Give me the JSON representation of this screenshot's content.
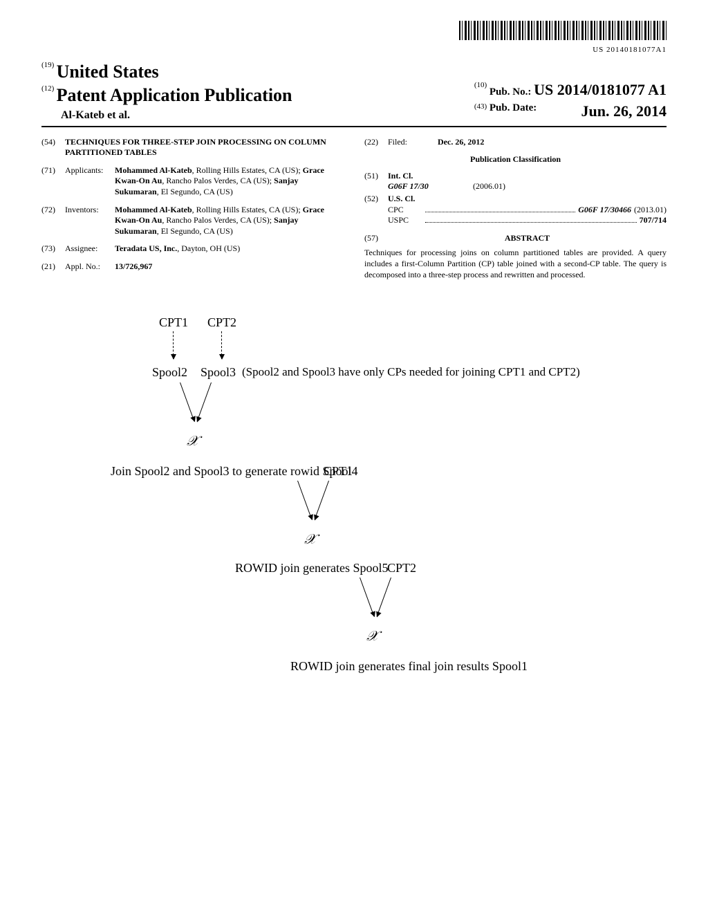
{
  "barcode_text": "US 20140181077A1",
  "header": {
    "code19": "(19)",
    "country": "United States",
    "code12": "(12)",
    "doc_type": "Patent Application Publication",
    "author_line": "Al-Kateb et al.",
    "code10": "(10)",
    "pubno_label": "Pub. No.:",
    "pubno_value": "US 2014/0181077 A1",
    "code43": "(43)",
    "pubdate_label": "Pub. Date:",
    "pubdate_value": "Jun. 26, 2014"
  },
  "left_col": {
    "title": {
      "code": "(54)",
      "text": "TECHNIQUES FOR THREE-STEP JOIN PROCESSING ON COLUMN PARTITIONED TABLES"
    },
    "applicants": {
      "code": "(71)",
      "label": "Applicants:",
      "text_parts": [
        {
          "bold": "Mohammed Al-Kateb",
          "rest": ", Rolling Hills Estates, CA (US); "
        },
        {
          "bold": "Grace Kwan-On Au",
          "rest": ", Rancho Palos Verdes, CA (US); "
        },
        {
          "bold": "Sanjay Sukumaran",
          "rest": ", El Segundo, CA (US)"
        }
      ]
    },
    "inventors": {
      "code": "(72)",
      "label": "Inventors:",
      "text_parts": [
        {
          "bold": "Mohammed Al-Kateb",
          "rest": ", Rolling Hills Estates, CA (US); "
        },
        {
          "bold": "Grace Kwan-On Au",
          "rest": ", Rancho Palos Verdes, CA (US); "
        },
        {
          "bold": "Sanjay Sukumaran",
          "rest": ", El Segundo, CA (US)"
        }
      ]
    },
    "assignee": {
      "code": "(73)",
      "label": "Assignee:",
      "bold": "Teradata US, Inc.",
      "rest": ", Dayton, OH (US)"
    },
    "appl_no": {
      "code": "(21)",
      "label": "Appl. No.:",
      "value": "13/726,967"
    }
  },
  "right_col": {
    "filed": {
      "code": "(22)",
      "label": "Filed:",
      "value": "Dec. 26, 2012"
    },
    "pub_cls_heading": "Publication Classification",
    "int_cl": {
      "code": "(51)",
      "label": "Int. Cl.",
      "cls": "G06F 17/30",
      "year": "(2006.01)"
    },
    "us_cl": {
      "code": "(52)",
      "label": "U.S. Cl.",
      "cpc_label": "CPC",
      "cpc_value": "G06F 17/30466",
      "cpc_year": "(2013.01)",
      "uspc_label": "USPC",
      "uspc_value": "707/714"
    },
    "abstract": {
      "code": "(57)",
      "heading": "ABSTRACT",
      "text": "Techniques for processing joins on column partitioned tables are provided. A query includes a first-Column Partition (CP) table joined with a second-CP table. The query is decomposed into a three-step process and rewritten and processed."
    }
  },
  "figure": {
    "cpt1": "CPT1",
    "cpt2": "CPT2",
    "spool2": "Spool2",
    "spool3": "Spool3",
    "note1": "(Spool2 and Spool3 have only CPs needed for joining CPT1 and CPT2)",
    "step1": "Join Spool2 and Spool3 to generate rowid Spool4",
    "cpt1b": "CPT1",
    "step2": "ROWID join generates Spool5",
    "cpt2b": "CPT2",
    "step3": "ROWID join generates final join results Spool1"
  }
}
